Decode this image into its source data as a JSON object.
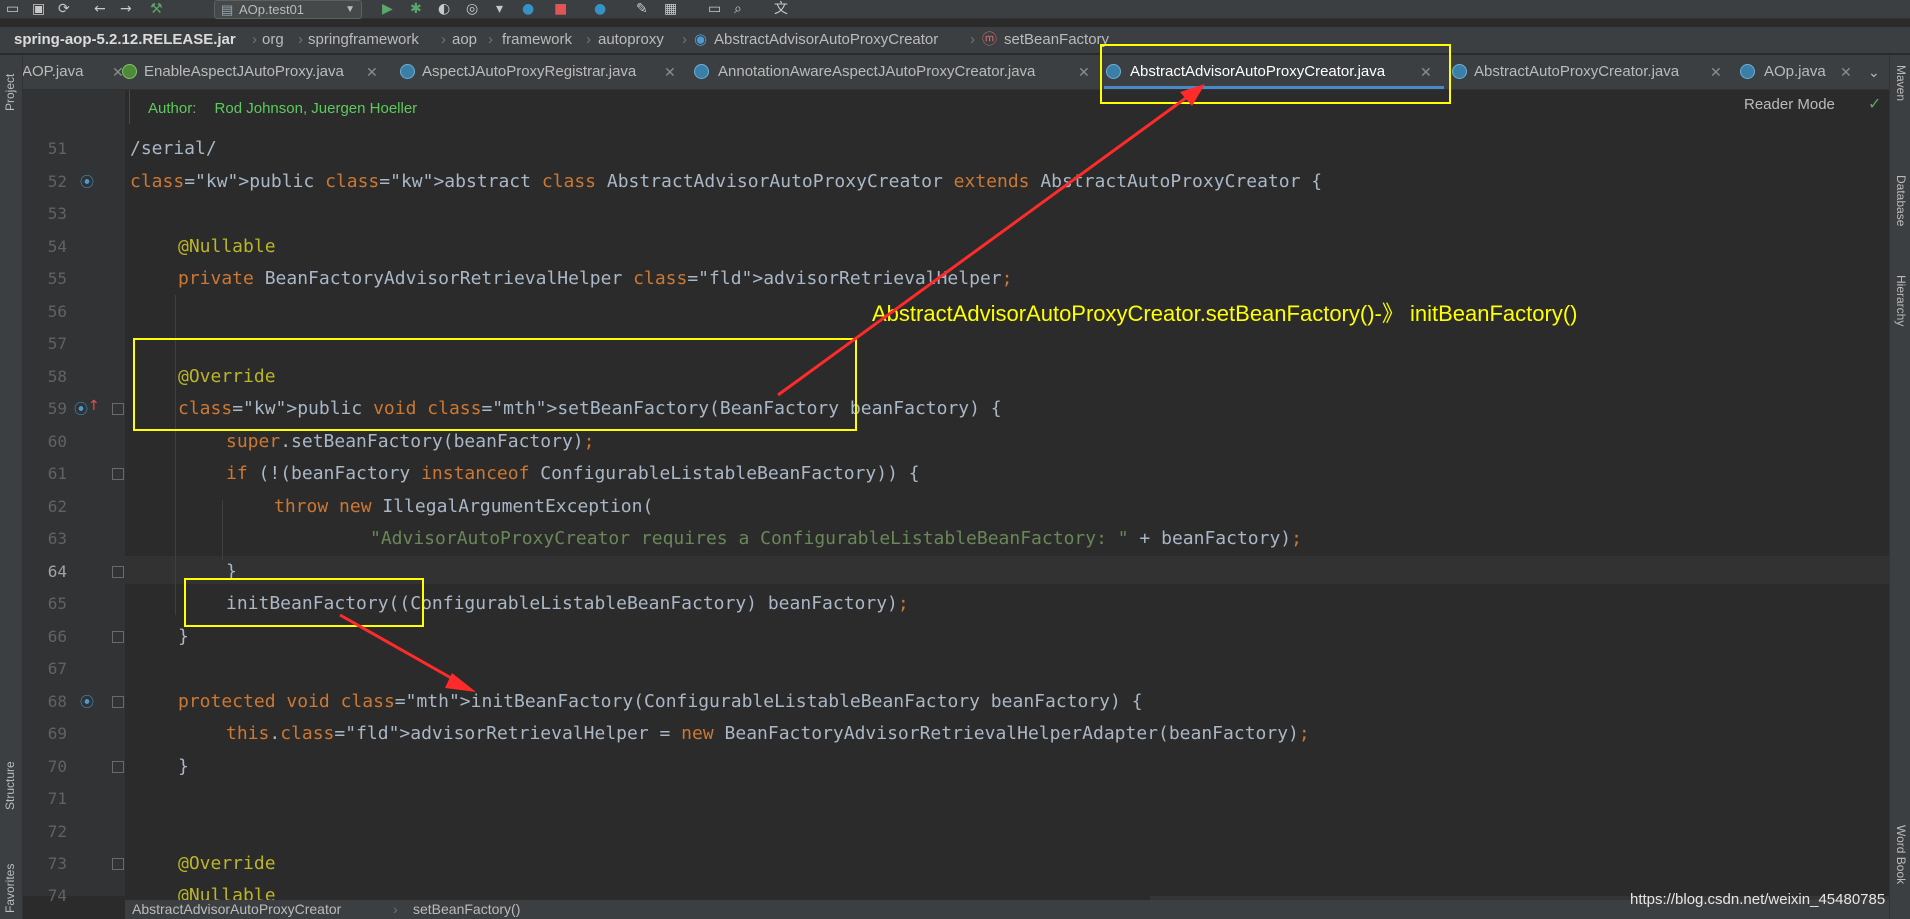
{
  "toolbar": {
    "run_config": "AOp.test01"
  },
  "breadcrumb": {
    "items": [
      "spring-aop-5.2.12.RELEASE.jar",
      "org",
      "springframework",
      "aop",
      "framework",
      "autoproxy",
      "AbstractAdvisorAutoProxyCreator",
      "setBeanFactory"
    ]
  },
  "tabs": [
    {
      "label": "AOP.java"
    },
    {
      "label": "EnableAspectJAutoProxy.java"
    },
    {
      "label": "AspectJAutoProxyRegistrar.java"
    },
    {
      "label": "AnnotationAwareAspectJAutoProxyCreator.java"
    },
    {
      "label": "AbstractAdvisorAutoProxyCreator.java"
    },
    {
      "label": "AbstractAutoProxyCreator.java"
    },
    {
      "label": "AOp.java"
    }
  ],
  "active_tab_index": 4,
  "side_panels": {
    "left": [
      "Project",
      "Structure",
      "Favorites"
    ],
    "right": [
      "Maven",
      "Database",
      "Hierarchy",
      "Word Book"
    ]
  },
  "editor": {
    "reader_mode": "Reader Mode",
    "author_label": "Author:",
    "author_value": "Rod Johnson, Juergen Hoeller",
    "current_line": 64,
    "lines": [
      {
        "n": "51",
        "text": "/serial/"
      },
      {
        "n": "52",
        "text": "public abstract class AbstractAdvisorAutoProxyCreator extends AbstractAutoProxyCreator {"
      },
      {
        "n": "53",
        "text": ""
      },
      {
        "n": "54",
        "text": "@Nullable"
      },
      {
        "n": "55",
        "text": "private BeanFactoryAdvisorRetrievalHelper advisorRetrievalHelper;"
      },
      {
        "n": "56",
        "text": ""
      },
      {
        "n": "57",
        "text": ""
      },
      {
        "n": "58",
        "text": "@Override"
      },
      {
        "n": "59",
        "text": "public void setBeanFactory(BeanFactory beanFactory) {"
      },
      {
        "n": "60",
        "text": "super.setBeanFactory(beanFactory);"
      },
      {
        "n": "61",
        "text": "if (!(beanFactory instanceof ConfigurableListableBeanFactory)) {"
      },
      {
        "n": "62",
        "text": "throw new IllegalArgumentException("
      },
      {
        "n": "63",
        "text": "\"AdvisorAutoProxyCreator requires a ConfigurableListableBeanFactory: \" + beanFactory);"
      },
      {
        "n": "64",
        "text": "}"
      },
      {
        "n": "65",
        "text": "initBeanFactory((ConfigurableListableBeanFactory) beanFactory);"
      },
      {
        "n": "66",
        "text": "}"
      },
      {
        "n": "67",
        "text": ""
      },
      {
        "n": "68",
        "text": "protected void initBeanFactory(ConfigurableListableBeanFactory beanFactory) {"
      },
      {
        "n": "69",
        "text": "this.advisorRetrievalHelper = new BeanFactoryAdvisorRetrievalHelperAdapter(beanFactory);"
      },
      {
        "n": "70",
        "text": "}"
      },
      {
        "n": "71",
        "text": ""
      },
      {
        "n": "72",
        "text": ""
      },
      {
        "n": "73",
        "text": "@Override"
      },
      {
        "n": "74",
        "text": "@Nullable"
      }
    ]
  },
  "annotation": {
    "text": "AbstractAdvisorAutoProxyCreator.setBeanFactory()-》 initBeanFactory()",
    "color": "#ffff00",
    "arrow_color": "#ff2b2b"
  },
  "bottom_breadcrumb": [
    "AbstractAdvisorAutoProxyCreator",
    "setBeanFactory()"
  ],
  "watermark": "https://blog.csdn.net/weixin_45480785",
  "colors": {
    "editor_bg": "#2b2b2b",
    "keyword": "#cc7832",
    "annotation": "#bbb529",
    "field": "#9876aa",
    "string": "#6a8759",
    "method": "#ffc66d"
  }
}
